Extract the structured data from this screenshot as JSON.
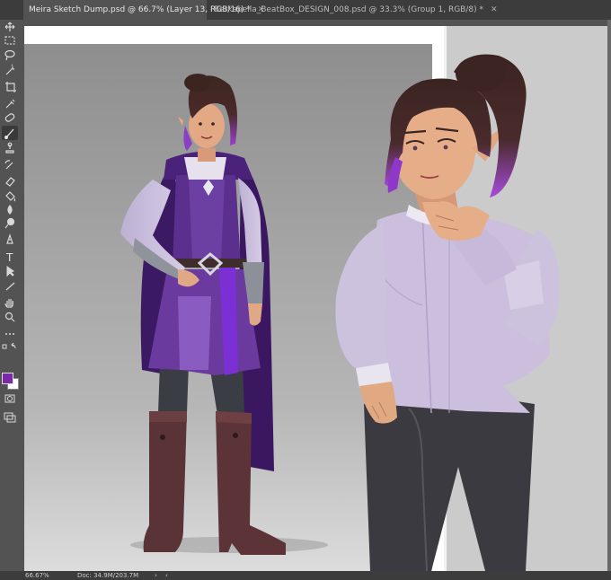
{
  "tabs": [
    {
      "label": "Meira Sketch Dump.psd @ 66.7% (Layer 13, RGB/16) *",
      "active": true
    },
    {
      "label": "Barkapella_BeatBox_DESIGN_008.psd @ 33.3% (Group 1, RGB/8) *",
      "active": false
    }
  ],
  "toolbar": {
    "tools": [
      "move-icon",
      "marquee-icon",
      "lasso-icon",
      "magic-wand-icon",
      "crop-icon",
      "eyedropper-icon",
      "healing-icon",
      "brush-icon",
      "clone-stamp-icon",
      "history-brush-icon",
      "eraser-icon",
      "paint-bucket-icon",
      "blur-icon",
      "dodge-icon",
      "pen-icon",
      "type-icon",
      "path-selection-icon",
      "line-icon",
      "hand-icon",
      "zoom-icon",
      "more-tools-icon"
    ],
    "active_tool": "brush-icon",
    "foreground_color": "#7a2aa6",
    "background_color": "#ffffff"
  },
  "status": {
    "zoom": "66.67%",
    "doc": "Doc: 34.9M/203.7M"
  }
}
